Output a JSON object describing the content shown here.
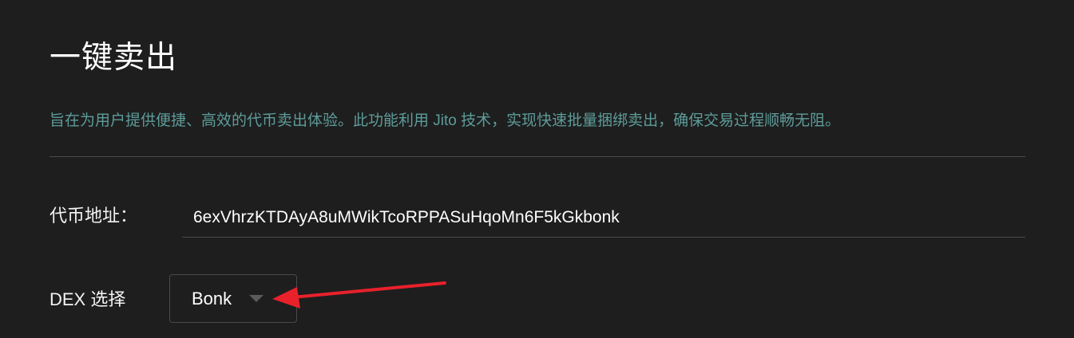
{
  "page": {
    "title": "一键卖出",
    "description": "旨在为用户提供便捷、高效的代币卖出体验。此功能利用 Jito 技术，实现快速批量捆绑卖出，确保交易过程顺畅无阻。"
  },
  "form": {
    "token_address": {
      "label": "代币地址：",
      "value": "6exVhrzKTDAyA8uMWikTcoRPPASuHqoMn6F5kGkbonk"
    },
    "dex": {
      "label": "DEX 选择",
      "selected": "Bonk",
      "icon": "chevron-down-icon"
    }
  },
  "colors": {
    "background": "#1e1e1e",
    "description_text": "#5d9c9a",
    "annotation_arrow": "#e8212b",
    "border": "#4a4a4a"
  }
}
